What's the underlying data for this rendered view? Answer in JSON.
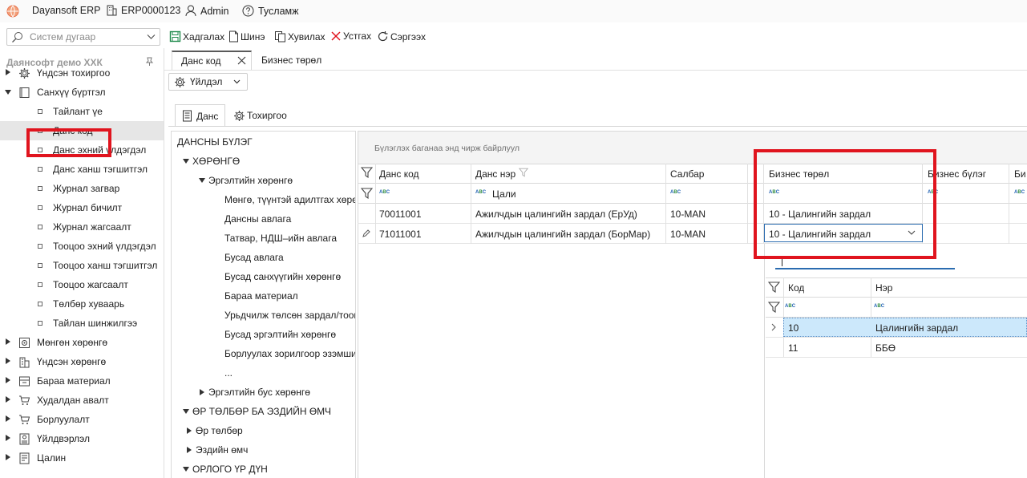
{
  "titlebar": {
    "app_name": "Dayansoft ERP",
    "company_code": "ERP0000123",
    "user": "Admin",
    "help": "Тусламж"
  },
  "search": {
    "placeholder": "Систем дугаар"
  },
  "toolbar": {
    "save": "Хадгалах",
    "new": "Шинэ",
    "copy": "Хувилах",
    "delete": "Устгах",
    "refresh": "Сэргээх"
  },
  "sidebar": {
    "company": "Даянсофт демо ХХК",
    "items": [
      {
        "label": "Үндсэн тохиргоо"
      },
      {
        "label": "Санхүү бүртгэл"
      },
      {
        "label": "Тайлант үе"
      },
      {
        "label": "Данс код"
      },
      {
        "label": "Данс эхний үлдэгдэл"
      },
      {
        "label": "Данс ханш тэгшитгэл"
      },
      {
        "label": "Журнал загвар"
      },
      {
        "label": "Журнал бичилт"
      },
      {
        "label": "Журнал жагсаалт"
      },
      {
        "label": "Тооцоо эхний үлдэгдэл"
      },
      {
        "label": "Тооцоо ханш тэгшитгэл"
      },
      {
        "label": "Тооцоо жагсаалт"
      },
      {
        "label": "Төлбөр хуваарь"
      },
      {
        "label": "Тайлан шинжилгээ"
      },
      {
        "label": "Мөнгөн хөрөнгө"
      },
      {
        "label": "Үндсэн хөрөнгө"
      },
      {
        "label": "Бараа материал"
      },
      {
        "label": "Худалдан авалт"
      },
      {
        "label": "Борлуулалт"
      },
      {
        "label": "Үйлдвэрлэл"
      },
      {
        "label": "Цалин"
      }
    ]
  },
  "tabs": {
    "active": "Данс код",
    "other": "Бизнес төрөл"
  },
  "action_button": "Үйлдэл",
  "subtabs": {
    "account": "Данс",
    "settings": "Тохиргоо"
  },
  "tree": {
    "root": "ДАНСНЫ БҮЛЭГ",
    "nodes": [
      "ХӨРӨНГӨ",
      "Эргэлтийн хөрөнгө",
      "Мөнгө, түүнтэй адилтгах хөрөнгө",
      "Дансны авлага",
      "Татвар, НДШ–ийн авлага",
      "Бусад авлага",
      "Бусад санхүүгийн хөрөнгө",
      "Бараа материал",
      "Урьдчилж төлсөн зардал/тооцоо",
      "Бусад эргэлтийн хөрөнгө",
      "Борлуулах зорилгоор эзэмшиж буй",
      "...",
      "Эргэлтийн бус хөрөнгө",
      "ӨР ТӨЛБӨР БА ЭЗДИЙН ӨМЧ",
      "Өр төлбөр",
      "Эздийн өмч",
      "ОРЛОГО ҮР ДҮН"
    ]
  },
  "grid": {
    "group_hint": "Бүлэглэх баганаа энд чирж байрлуул",
    "columns": [
      "Данс код",
      "Данс нэр",
      "Салбар",
      "Бизнес төрөл",
      "Бизнес бүлэг",
      "Би"
    ],
    "filter_name_value": "Цали",
    "rows": [
      {
        "code": "70011001",
        "name": "Ажилчдын цалингийн зардал (ЕрУд)",
        "branch": "10-MAN",
        "biz_type": "10 - Цалингийн зардал"
      },
      {
        "code": "71011001",
        "name": "Ажилчдын цалингийн зардал (БорМар)",
        "branch": "10-MAN",
        "biz_type": "10 - Цалингийн зардал"
      }
    ]
  },
  "dropdown": {
    "search_value": "",
    "columns": [
      "Код",
      "Нэр"
    ],
    "rows": [
      {
        "code": "10",
        "name": "Цалингийн зардал"
      },
      {
        "code": "11",
        "name": "ББӨ"
      }
    ]
  },
  "abc_icon": {
    "a": "A",
    "b": "B",
    "c": "C"
  },
  "colors": {
    "highlight": "#e0141e",
    "selected_row": "#cce8fb",
    "tree_bg": "#ffffff"
  }
}
